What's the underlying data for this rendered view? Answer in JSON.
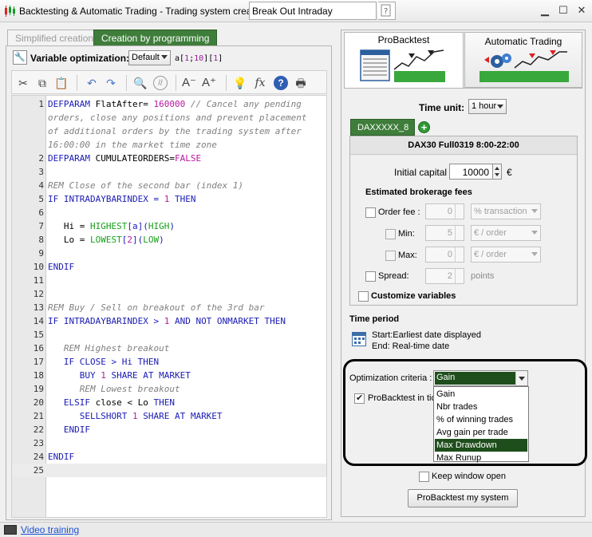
{
  "window": {
    "title": "Backtesting & Automatic Trading - Trading system creation",
    "system_name": "Break Out Intraday",
    "help_icon": "help-page-icon",
    "controls": [
      "minimize",
      "maximize",
      "close"
    ]
  },
  "left_tabs": {
    "simplified": "Simplified creation",
    "programming": "Creation by programming"
  },
  "variable_optimization": {
    "label": "Variable optimization:",
    "selected": "Default",
    "variables_prefix": "a",
    "variables_lbracket": "[",
    "variables_p1": "1",
    "variables_sep": ";",
    "variables_p2": "10",
    "variables_mid": "][",
    "variables_p3": "1",
    "variables_rbracket": "]"
  },
  "editor_toolbar": [
    {
      "name": "cut-icon",
      "glyph": "✂"
    },
    {
      "name": "copy-icon",
      "glyph": "⧉"
    },
    {
      "name": "paste-icon",
      "glyph": "📋"
    },
    {
      "name": "undo-icon",
      "glyph": "↶"
    },
    {
      "name": "redo-icon",
      "glyph": "↷"
    },
    {
      "name": "search-icon",
      "glyph": "🔍"
    },
    {
      "name": "comment-icon",
      "glyph": "//"
    },
    {
      "name": "font-decrease-icon",
      "glyph": "A⁻"
    },
    {
      "name": "font-increase-icon",
      "glyph": "A⁺"
    },
    {
      "name": "tip-bulb-icon",
      "glyph": "💡"
    },
    {
      "name": "function-icon",
      "glyph": "fx"
    },
    {
      "name": "help-icon",
      "glyph": "?"
    },
    {
      "name": "print-icon",
      "glyph": "🖶"
    }
  ],
  "code": {
    "line_numbers": [
      "1",
      "",
      "",
      "",
      "2",
      "3",
      "4",
      "5",
      "6",
      "7",
      "8",
      "9",
      "10",
      "11",
      "12",
      "13",
      "14",
      "15",
      "16",
      "17",
      "18",
      "19",
      "20",
      "21",
      "22",
      "23",
      "24",
      "25"
    ],
    "l1": {
      "kw": "DEFPARAM",
      "name": " FlatAfter= ",
      "num": "160000",
      "comment": " // Cancel any pending"
    },
    "l1b": "orders, close any positions and prevent placement",
    "l1c": "of additional orders by the trading system after",
    "l1d": "16:00:00 in the market time zone",
    "l2": {
      "kw": "DEFPARAM",
      "name": " CUMULATEORDERS=",
      "val": "FALSE"
    },
    "l4": "REM Close of the second bar (index 1)",
    "l5": {
      "kw": "IF",
      "name": " INTRADAYBARINDEX = ",
      "num": "1",
      "kw2": " THEN"
    },
    "l7": {
      "pre": "   Hi = ",
      "fn": "HIGHEST",
      "a": "[a](",
      "fn2": "HIGH",
      "b": ")"
    },
    "l8": {
      "pre": "   Lo = ",
      "fn": "LOWEST",
      "a": "[",
      "num": "2",
      "b": "](",
      "fn2": "LOW",
      "c": ")"
    },
    "l10": "ENDIF",
    "l13": "REM Buy / Sell on breakout of the 3rd bar",
    "l14": {
      "kw": "IF",
      "name": " INTRADAYBARINDEX > ",
      "num": "1",
      "kw2": " AND NOT ONMARKET THEN"
    },
    "l16": "   REM Highest breakout",
    "l17": {
      "kw": "   IF CLOSE",
      "op": " > Hi ",
      "kw2": "THEN"
    },
    "l18": {
      "kw": "      BUY ",
      "num": "1",
      "kw2": " SHARE AT MARKET"
    },
    "l19": "      REM Lowest breakout",
    "l20": {
      "kw": "   ELSIF",
      "name": " close < Lo ",
      "kw2": "THEN"
    },
    "l21": {
      "kw": "      SELLSHORT ",
      "num": "1",
      "kw2": " SHARE AT MARKET"
    },
    "l22": "   ENDIF",
    "l24": "ENDIF"
  },
  "status_bar": {
    "video_link": "Video training"
  },
  "right_tabs": {
    "probacktest": "ProBacktest",
    "automatic": "Automatic Trading"
  },
  "time_unit": {
    "label": "Time unit:",
    "value": "1 hour"
  },
  "instrument": {
    "tab": "DAXXXXX_8",
    "header": "DAX30 Full0319 8:00-22:00"
  },
  "capital": {
    "label": "Initial capital :",
    "value": "10000",
    "currency": "€"
  },
  "fees": {
    "title": "Estimated brokerage fees",
    "order_fee_label": "Order fee :",
    "order_fee_value": "0",
    "order_fee_unit": "% transaction",
    "min_label": "Min:",
    "min_value": "5",
    "min_unit": "€ / order",
    "max_label": "Max:",
    "max_value": "0",
    "max_unit": "€ / order",
    "spread_label": "Spread:",
    "spread_value": "2",
    "spread_unit": "points"
  },
  "customize_label": "Customize variables",
  "time_period": {
    "title": "Time period",
    "start": "Start:Earliest date displayed",
    "end": "End:  Real-time date"
  },
  "optimization": {
    "label": "Optimization criteria :",
    "selected": "Gain",
    "ticks_label": "ProBacktest in tick",
    "options": [
      "Gain",
      "Nbr trades",
      "% of winning trades",
      "Avg gain per trade",
      "Max Drawdown",
      "Max Runup"
    ],
    "highlighted": "Max Drawdown"
  },
  "keep_window_label": "Keep window open",
  "probacktest_button": "ProBacktest my system",
  "colors": {
    "accent_green": "#3f7d3b",
    "selection_green": "#1e4e1c",
    "keyword_blue": "#1a1ab5",
    "number_magenta": "#b8179f",
    "function_green": "#17a019",
    "comment_gray": "#808080"
  }
}
